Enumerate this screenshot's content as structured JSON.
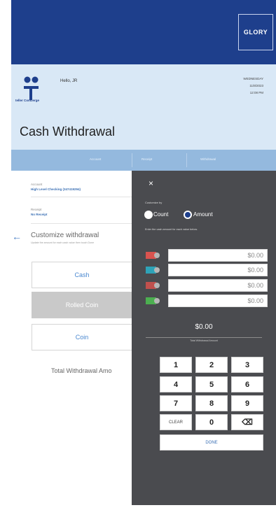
{
  "brand": {
    "logo_text": "GLORY",
    "brand_name": "teller Concierge"
  },
  "header": {
    "greeting": "Hello, JR",
    "date_lines": [
      "WEDNESDAY",
      "11/8/2023",
      "12:08 PM"
    ],
    "title": "Cash Withdrawal"
  },
  "steps": [
    "Account",
    "Receipt",
    "Withdrawal"
  ],
  "left": {
    "account_label": "Account",
    "account_value": "High Level Checking (347419294)",
    "receipt_label": "Receipt",
    "receipt_value": "No Receipt",
    "customize_title": "Customize withdrawal",
    "customize_sub": "Update the amount for each cash value then touch Done",
    "options": [
      "Cash",
      "Rolled Coin",
      "Coin"
    ],
    "total_label": "Total Withdrawal Amo"
  },
  "panel": {
    "close": "×",
    "customize_by": "Customize by",
    "radio_count": "Count",
    "radio_amount": "Amount",
    "enter_label": "Enter the cash amount for each value below.",
    "denominations": [
      {
        "color": "#d9534f",
        "value": "$0.00"
      },
      {
        "color": "#2ea3b8",
        "value": "$0.00"
      },
      {
        "color": "#c0504d",
        "value": "$0.00"
      },
      {
        "color": "#4caf50",
        "value": "$0.00"
      }
    ],
    "total": "$0.00",
    "total_label": "Total Withdrawal Amount",
    "keys": [
      "1",
      "2",
      "3",
      "4",
      "5",
      "6",
      "7",
      "8",
      "9",
      "CLEAR",
      "0",
      "⌫"
    ],
    "done": "DONE"
  },
  "colors": {
    "brand_blue": "#1e3f8c",
    "header_bg": "#d9e8f6",
    "steps_bg": "#94b9de",
    "panel_bg": "#4a4b4f"
  }
}
